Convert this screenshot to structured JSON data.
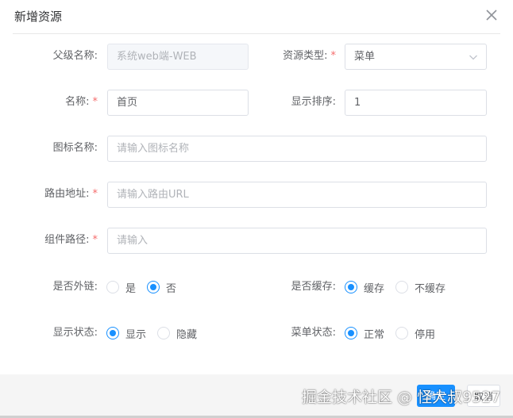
{
  "dialog": {
    "title": "新增资源"
  },
  "fields": {
    "parent_name": {
      "label": "父级名称:",
      "value": "系统web端-WEB"
    },
    "resource_type": {
      "label": "资源类型:",
      "required": "*",
      "value": "菜单"
    },
    "name": {
      "label": "名称:",
      "required": "*",
      "value": "首页"
    },
    "sort": {
      "label": "显示排序:",
      "value": "1"
    },
    "icon_name": {
      "label": "图标名称:",
      "placeholder": "请输入图标名称"
    },
    "route": {
      "label": "路由地址:",
      "required": "*",
      "placeholder": "请输入路由URL"
    },
    "component": {
      "label": "组件路径:",
      "required": "*",
      "placeholder": "请输入"
    },
    "external_link": {
      "label": "是否外链:",
      "options": [
        "是",
        "否"
      ],
      "selected": "否"
    },
    "cache": {
      "label": "是否缓存:",
      "options": [
        "缓存",
        "不缓存"
      ],
      "selected": "缓存"
    },
    "visible": {
      "label": "显示状态:",
      "options": [
        "显示",
        "隐藏"
      ],
      "selected": "显示"
    },
    "menu_status": {
      "label": "菜单状态:",
      "options": [
        "正常",
        "停用"
      ],
      "selected": "正常"
    }
  },
  "footer": {
    "confirm_label": "确定",
    "cancel_label": "取消",
    "watermark": "掘金技术社区 @ 怪大叔9527"
  },
  "colors": {
    "accent": "#1890ff",
    "required": "#f56c6c"
  },
  "icons": {
    "close": "close-icon",
    "select_arrow": "chevron-down-icon"
  }
}
